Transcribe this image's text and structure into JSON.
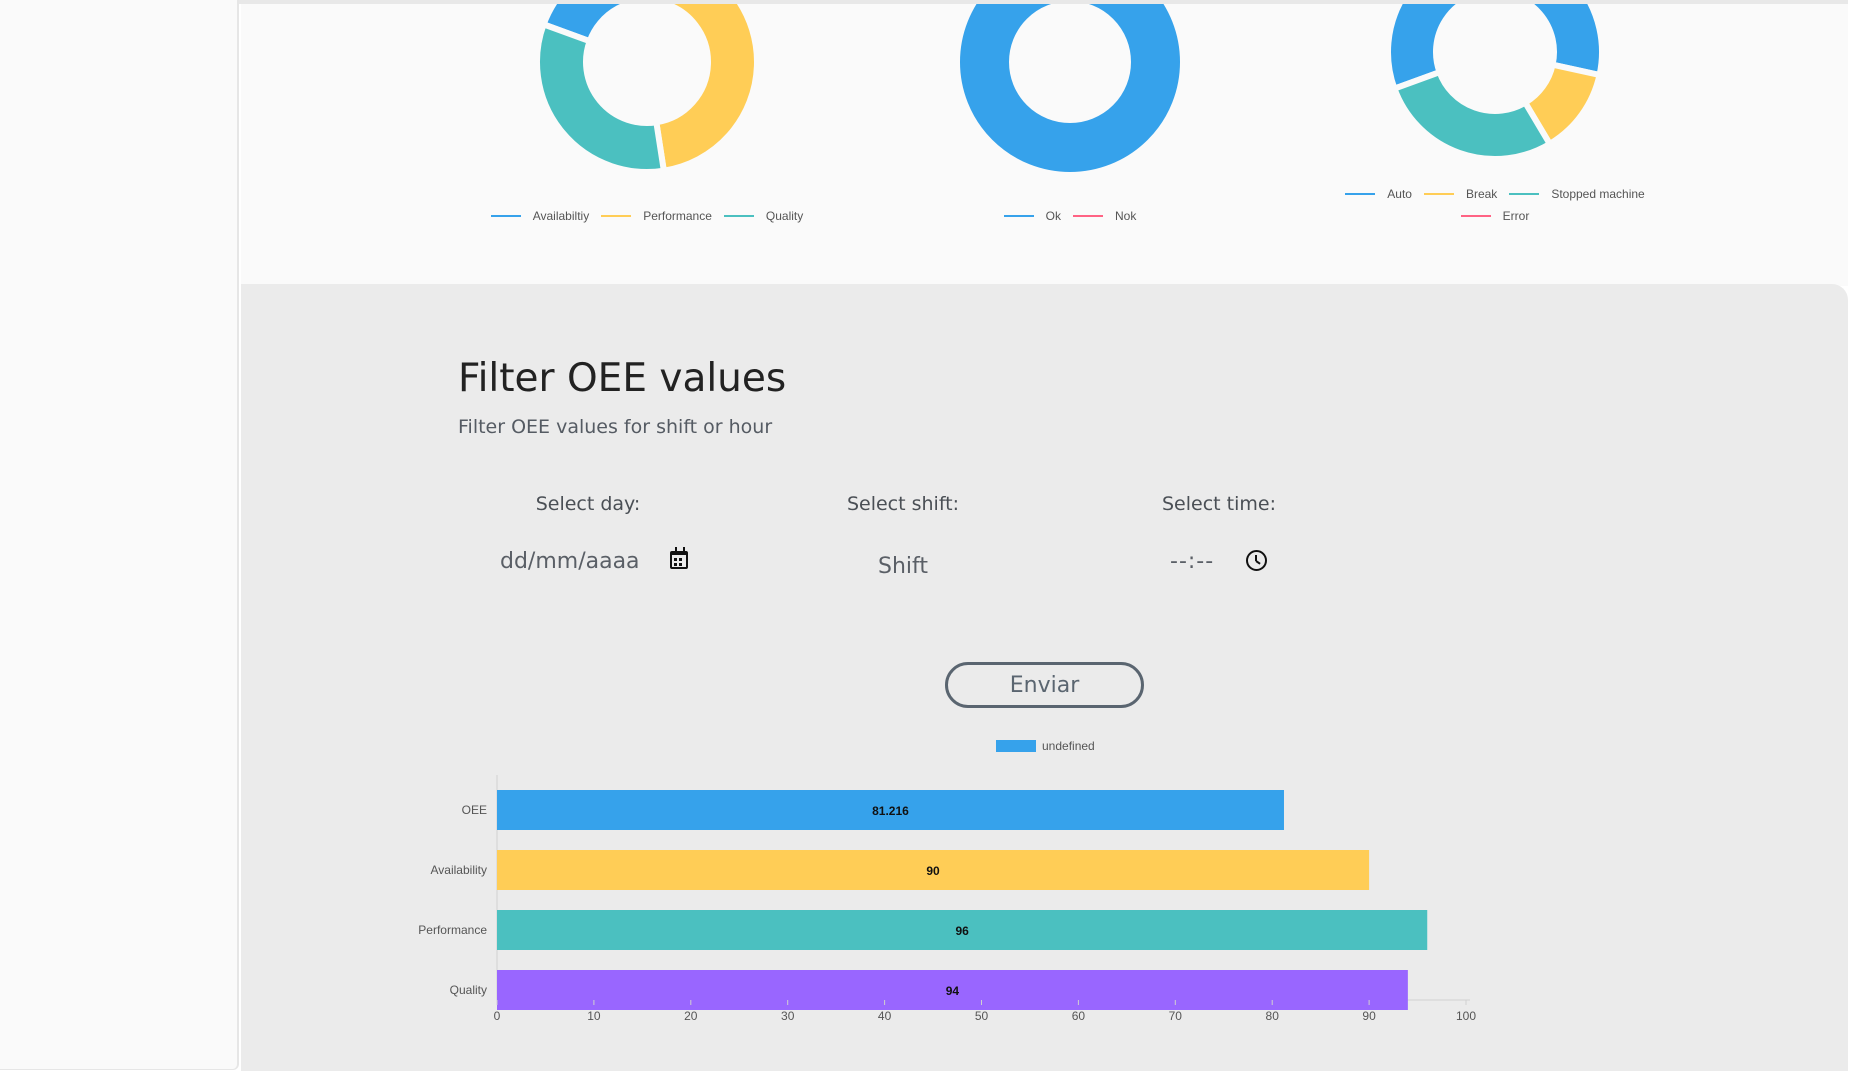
{
  "colors": {
    "blue": "#36a2eb",
    "yellow": "#ffcd56",
    "teal": "#4bc0c0",
    "pink": "#ff6384",
    "purple": "#9966ff",
    "panel_bg": "#fafafa",
    "card_bg": "#ebebeb"
  },
  "donuts": [
    {
      "segments": [
        {
          "label": "Availabiltiy",
          "value": 0.23,
          "color": "#36a2eb"
        },
        {
          "label": "Performance",
          "value": 0.44,
          "color": "#ffcd56"
        },
        {
          "label": "Quality",
          "value": 0.33,
          "color": "#4bc0c0"
        }
      ],
      "legend": [
        "Availabiltiy",
        "Performance",
        "Quality"
      ]
    },
    {
      "segments": [
        {
          "label": "Ok",
          "value": 1.0,
          "color": "#36a2eb"
        },
        {
          "label": "Nok",
          "value": 0.0,
          "color": "#ff6384"
        }
      ],
      "legend": [
        "Ok",
        "Nok"
      ]
    },
    {
      "segments": [
        {
          "label": "Auto",
          "value": 0.59,
          "color": "#36a2eb"
        },
        {
          "label": "Break",
          "value": 0.13,
          "color": "#ffcd56"
        },
        {
          "label": "Stopped machine",
          "value": 0.28,
          "color": "#4bc0c0"
        },
        {
          "label": "Error",
          "value": 0.0,
          "color": "#ff6384"
        }
      ],
      "legend": [
        "Auto",
        "Break",
        "Stopped machine",
        "Error"
      ]
    }
  ],
  "filter": {
    "title": "Filter OEE values",
    "subtitle": "Filter OEE values for shift or hour",
    "day_label": "Select day:",
    "shift_label": "Select shift:",
    "time_label": "Select time:",
    "day_placeholder": "dd/mm/aaaa",
    "shift_value": "Shift",
    "time_placeholder": "--:--",
    "submit_label": "Enviar"
  },
  "chart_data": {
    "type": "bar",
    "orientation": "horizontal",
    "legend": "undefined",
    "categories": [
      "OEE",
      "Availability",
      "Performance",
      "Quality"
    ],
    "values": [
      81.216,
      90,
      96,
      94
    ],
    "value_labels": [
      "81.216",
      "90",
      "96",
      "94"
    ],
    "colors": [
      "#36a2eb",
      "#ffcd56",
      "#4bc0c0",
      "#9966ff"
    ],
    "xlim": [
      0,
      100
    ],
    "xticks": [
      "0",
      "10",
      "20",
      "30",
      "40",
      "50",
      "60",
      "70",
      "80",
      "90",
      "100"
    ],
    "grid": false,
    "legend_position": "top"
  }
}
